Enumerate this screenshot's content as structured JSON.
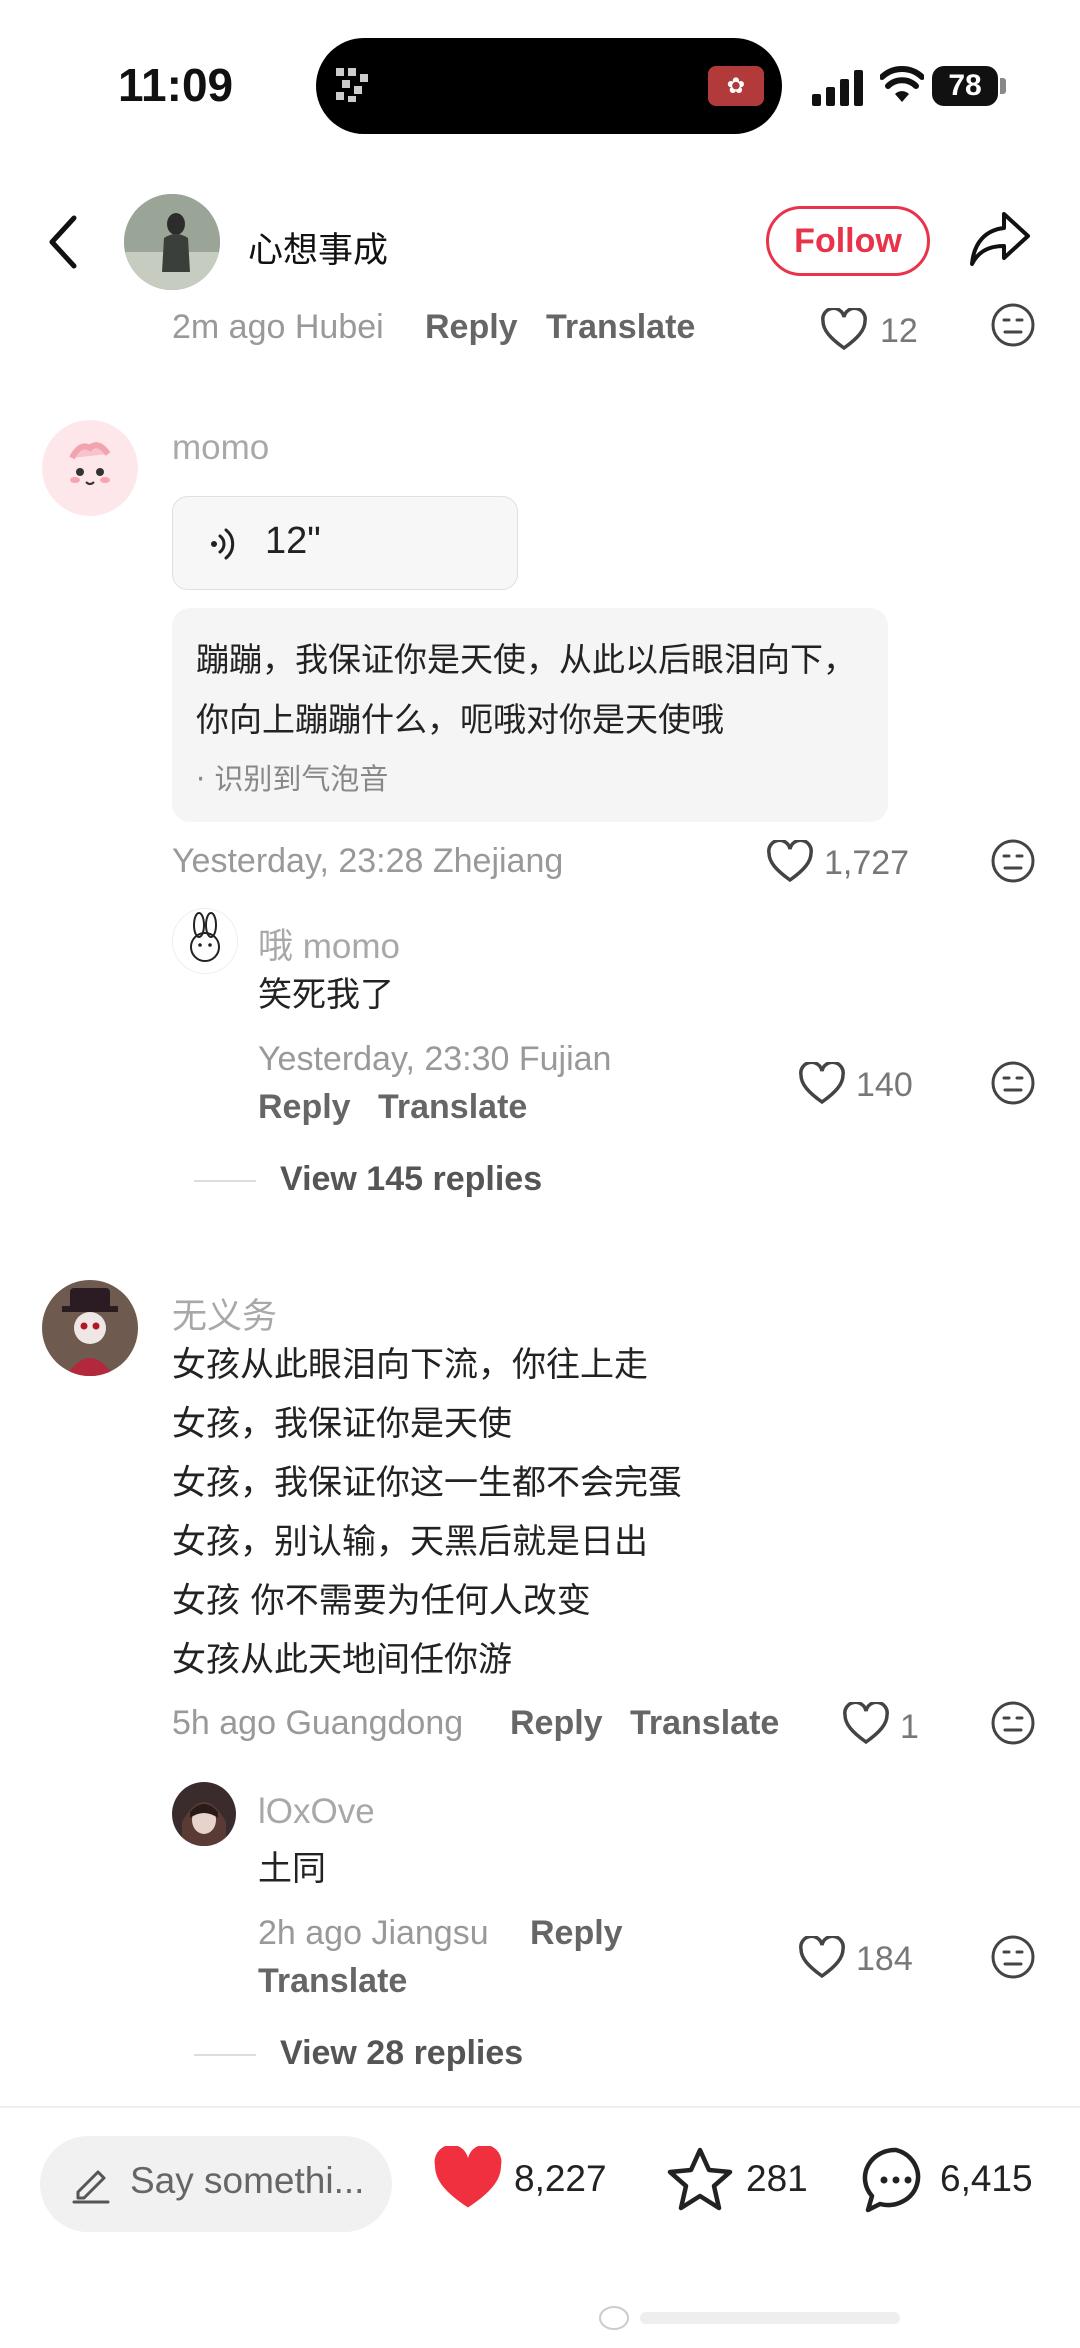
{
  "status_bar": {
    "time": "11:09",
    "battery": "78"
  },
  "header": {
    "author_name": "心想事成",
    "follow_label": "Follow"
  },
  "prev_comment": {
    "meta": "2m ago Hubei",
    "reply": "Reply",
    "translate": "Translate",
    "likes": "12"
  },
  "comments": [
    {
      "user": "momo",
      "voice_duration": "12\"",
      "transcript": "蹦蹦，我保证你是天使，从此以后眼泪向下，你向上蹦蹦什么，呃哦对你是天使哦",
      "transcript_note": "· 识别到气泡音",
      "meta": "Yesterday, 23:28 Zhejiang",
      "likes": "1,727",
      "reply": {
        "user": "哦 momo",
        "text": "笑死我了",
        "meta": "Yesterday, 23:30 Fujian",
        "reply_label": "Reply",
        "translate_label": "Translate",
        "likes": "140"
      },
      "view_replies": "View 145 replies"
    },
    {
      "user": "无义务",
      "lines": [
        "女孩从此眼泪向下流，你往上走",
        "女孩，我保证你是天使",
        "女孩，我保证你这一生都不会完蛋",
        "女孩，别认输，天黑后就是日出",
        "女孩 你不需要为任何人改变",
        "女孩从此天地间任你游"
      ],
      "meta": "5h ago Guangdong",
      "reply_label": "Reply",
      "translate_label": "Translate",
      "likes": "1",
      "reply": {
        "user": "lOxOve",
        "text": "土同",
        "meta": "2h ago Jiangsu",
        "reply_label": "Reply",
        "translate_label": "Translate",
        "likes": "184"
      },
      "view_replies": "View 28 replies"
    }
  ],
  "bottom_bar": {
    "input_placeholder": "Say somethi...",
    "likes": "8,227",
    "favorites": "281",
    "comments": "6,415"
  },
  "colors": {
    "accent": "#e8334a",
    "like_red": "#f0303f"
  }
}
